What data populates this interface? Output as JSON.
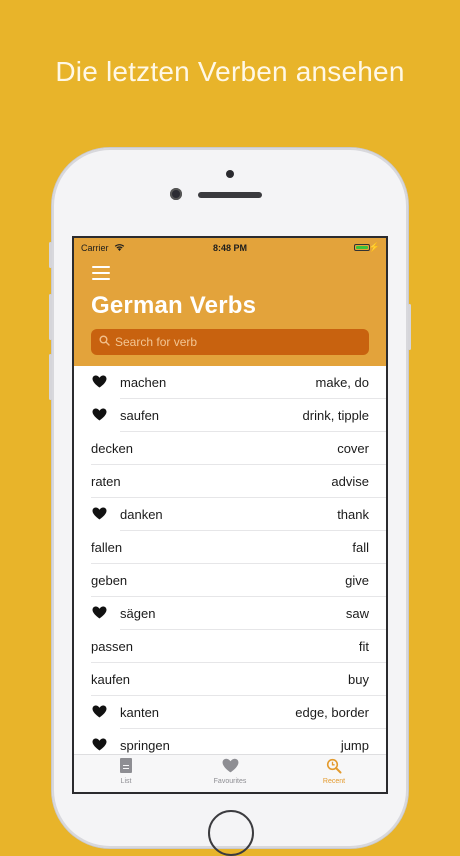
{
  "headline": "Die letzten Verben ansehen",
  "status_bar": {
    "carrier": "Carrier",
    "time": "8:48 PM"
  },
  "header": {
    "title": "German Verbs"
  },
  "search": {
    "placeholder": "Search for verb"
  },
  "verbs": [
    {
      "german": "machen",
      "english": "make, do",
      "favourite": true
    },
    {
      "german": "saufen",
      "english": "drink, tipple",
      "favourite": true
    },
    {
      "german": "decken",
      "english": "cover",
      "favourite": false
    },
    {
      "german": "raten",
      "english": "advise",
      "favourite": false
    },
    {
      "german": "danken",
      "english": "thank",
      "favourite": true
    },
    {
      "german": "fallen",
      "english": "fall",
      "favourite": false
    },
    {
      "german": "geben",
      "english": "give",
      "favourite": false
    },
    {
      "german": "sägen",
      "english": "saw",
      "favourite": true
    },
    {
      "german": "passen",
      "english": "fit",
      "favourite": false
    },
    {
      "german": "kaufen",
      "english": "buy",
      "favourite": false
    },
    {
      "german": "kanten",
      "english": "edge, border",
      "favourite": true
    },
    {
      "german": "springen",
      "english": "jump",
      "favourite": true
    }
  ],
  "tabs": [
    {
      "label": "List",
      "icon": "document-icon",
      "active": false
    },
    {
      "label": "Favourites",
      "icon": "heart-icon",
      "active": false
    },
    {
      "label": "Recent",
      "icon": "recent-search-icon",
      "active": true
    }
  ],
  "colors": {
    "background": "#e8b42a",
    "header": "#e3a33b",
    "search_field": "#c8620f",
    "active_tab": "#e39a2d"
  }
}
